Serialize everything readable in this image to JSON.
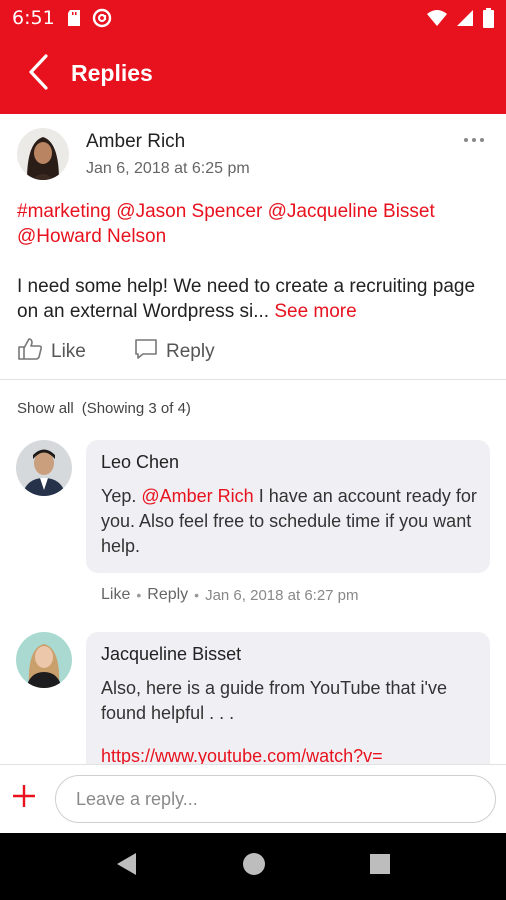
{
  "status_bar": {
    "time": "6:51",
    "icons": [
      "sd-card-icon",
      "at-sign-icon",
      "wifi-icon",
      "signal-icon",
      "battery-icon"
    ]
  },
  "app_bar": {
    "title": "Replies",
    "back_icon": "back-chevron-icon"
  },
  "post": {
    "author": "Amber Rich",
    "timestamp": "Jan 6, 2018 at 6:25 pm",
    "tags": [
      "#marketing",
      "@Jason Spencer",
      "@Jacqueline Bisset",
      "@Howard Nelson"
    ],
    "body": "I need some help! We need to create a recruiting page on an external Wordpress si...",
    "see_more": "See more",
    "like_label": "Like",
    "reply_label": "Reply"
  },
  "replies_header": {
    "show_all": "Show all",
    "showing": "(Showing 3 of 4)"
  },
  "comments": [
    {
      "author": "Leo Chen",
      "text_before": "Yep. ",
      "mention": "@Amber Rich",
      "text_after": " I have an account ready for you.  Also feel free to schedule time if you want help.",
      "like_label": "Like",
      "reply_label": "Reply",
      "timestamp": "Jan 6, 2018 at 6:27 pm"
    },
    {
      "author": "Jacqueline Bisset",
      "text": "Also, here is a guide from YouTube that i've found helpful . . .",
      "link": "https://www.youtube.com/watch?v="
    }
  ],
  "composer": {
    "placeholder": "Leave a reply...",
    "add_icon": "plus-icon"
  },
  "nav_bar": {
    "icons": [
      "back-triangle-icon",
      "home-circle-icon",
      "recents-square-icon"
    ]
  },
  "colors": {
    "brand": "#e8121e",
    "bubble": "#f0f0f4",
    "nav": "#000000"
  }
}
